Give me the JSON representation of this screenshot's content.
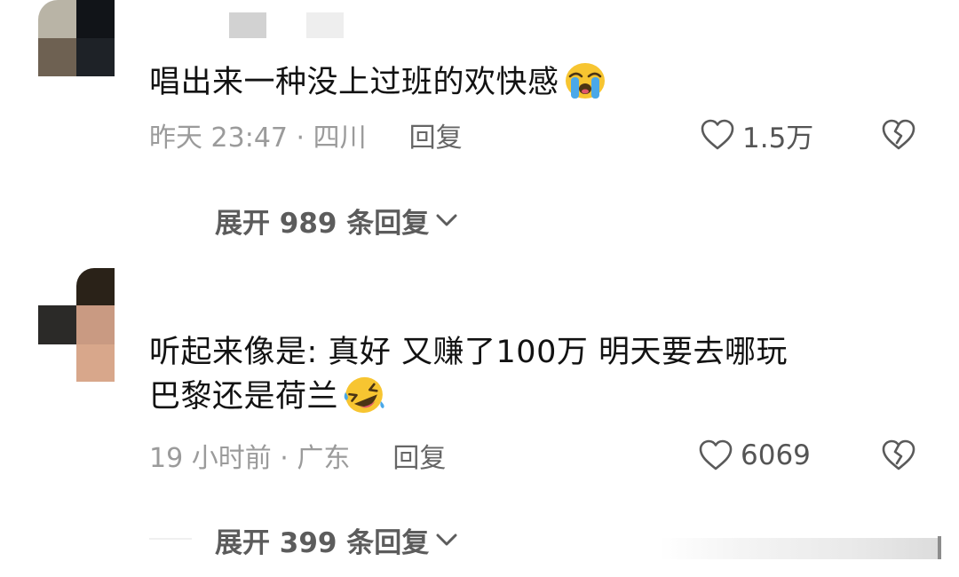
{
  "comments": [
    {
      "text": "唱出来一种没上过班的欢快感",
      "emoji": "loudly-crying-face",
      "meta": "昨天 23:47 · 四川",
      "reply_label": "回复",
      "likes": "1.5万",
      "expand_label": "展开 989 条回复"
    },
    {
      "text": "听起来像是: 真好 又赚了100万 明天要去哪玩",
      "text_line2": "巴黎还是荷兰",
      "emoji": "rolling-on-floor-laughing",
      "meta": "19 小时前 · 广东",
      "reply_label": "回复",
      "likes": "6069",
      "expand_label": "展开 399 条回复"
    }
  ],
  "colors": {
    "text": "#121212",
    "meta": "#9b9b9b",
    "action": "#555555",
    "expand": "#5c5c5c",
    "emoji_face": "#f7c531",
    "tear": "#4aa8e8"
  }
}
